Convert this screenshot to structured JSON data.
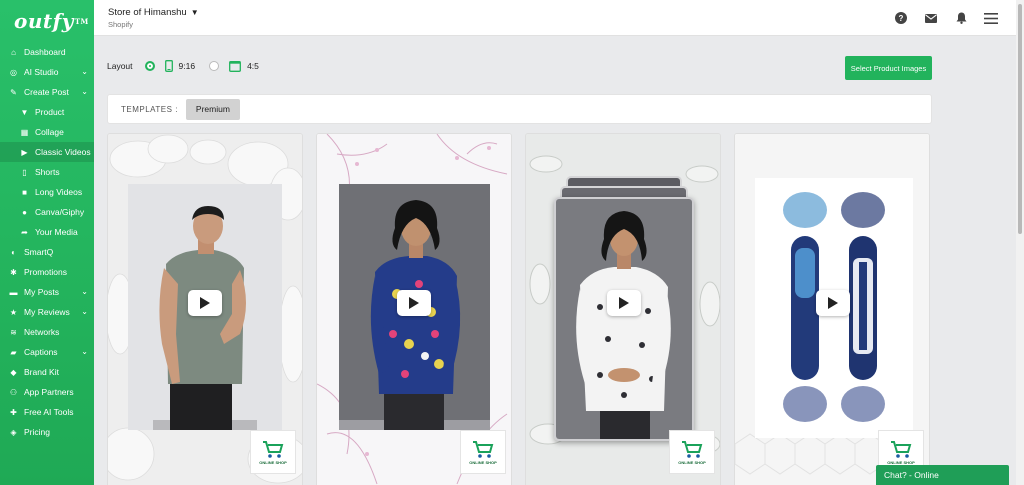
{
  "brand": {
    "logo_text": "outfy",
    "logo_tm": "TM"
  },
  "sidebar": {
    "items": [
      {
        "label": "Dashboard",
        "icon": "dashboard-icon"
      },
      {
        "label": "AI Studio",
        "icon": "ai-icon",
        "has_chevron": true
      },
      {
        "label": "Create Post",
        "icon": "pencil-icon",
        "has_chevron": true
      },
      {
        "label": "Product",
        "icon": "shirt-icon",
        "sub": true
      },
      {
        "label": "Collage",
        "icon": "grid-icon",
        "sub": true
      },
      {
        "label": "Classic Videos",
        "icon": "play-icon",
        "sub": true,
        "active": true
      },
      {
        "label": "Shorts",
        "icon": "phone-icon",
        "sub": true
      },
      {
        "label": "Long Videos",
        "icon": "video-icon",
        "sub": true
      },
      {
        "label": "Canva/Giphy",
        "icon": "canva-icon",
        "sub": true
      },
      {
        "label": "Your Media",
        "icon": "share-icon",
        "sub": true
      },
      {
        "label": "SmartQ",
        "icon": "smartq-icon"
      },
      {
        "label": "Promotions",
        "icon": "gear-icon"
      },
      {
        "label": "My Posts",
        "icon": "folder-icon",
        "has_chevron": true
      },
      {
        "label": "My Reviews",
        "icon": "star-icon",
        "has_chevron": true
      },
      {
        "label": "Networks",
        "icon": "wifi-icon"
      },
      {
        "label": "Captions",
        "icon": "caption-icon",
        "has_chevron": true
      },
      {
        "label": "Brand Kit",
        "icon": "shield-icon"
      },
      {
        "label": "App Partners",
        "icon": "users-icon"
      },
      {
        "label": "Free AI Tools",
        "icon": "tools-icon"
      },
      {
        "label": "Pricing",
        "icon": "tag-icon"
      }
    ]
  },
  "header": {
    "store_name": "Store of Himanshu",
    "platform": "Shopify",
    "icons": [
      "help-icon",
      "mail-icon",
      "bell-icon",
      "menu-icon"
    ]
  },
  "layout": {
    "label": "Layout",
    "options": [
      {
        "label": "9:16",
        "selected": true
      },
      {
        "label": "4:5",
        "selected": false
      }
    ]
  },
  "select_button": "Select Product Images",
  "templates": {
    "label": "TEMPLATES :",
    "active": "Premium"
  },
  "cards": [
    {
      "name": "card-grey-tshirt",
      "background": "white-flowers",
      "shirt": "#7e8a80"
    },
    {
      "name": "card-skull-shirt",
      "background": "pink-branches",
      "shirt": "#243c8a"
    },
    {
      "name": "card-white-print-shirt",
      "background": "white-leaves",
      "shirt": "#f4f4f4"
    },
    {
      "name": "card-snowboard",
      "background": "white-hexagons",
      "shirt": "#2a3f8f"
    }
  ],
  "badge_text": "ONLINE SHOP",
  "chat": {
    "label": "Chat? - Online"
  },
  "colors": {
    "primary": "#22b35c",
    "sidebar": "#26b862",
    "chat": "#1f9e57"
  }
}
